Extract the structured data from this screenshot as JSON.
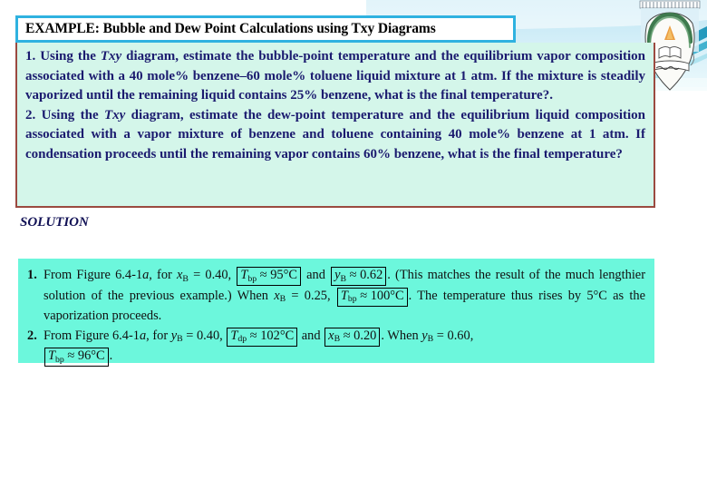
{
  "slide": {
    "title": "EXAMPLE: Bubble and Dew Point Calculations using Txy Diagrams",
    "solution_heading": "SOLUTION"
  },
  "colors": {
    "title_border": "#2FB2E0",
    "content_bg": "#D4F6EA",
    "content_border": "#9B4A40",
    "solution_bg": "#6CF7DC",
    "question_text": "#1B1B6F",
    "solution_text": "#111111",
    "background": "#FFFFFF",
    "deco_cyan": "#2FB2E0",
    "deco_pale": "#CDEAF4"
  },
  "questions": [
    {
      "number": "1.",
      "seg_a": "Using the ",
      "italic": "Txy",
      "seg_b": " diagram, estimate the bubble-point temperature and the equilibrium vapor composition associated with a 40 mole% benzene–60 mole% toluene liquid mixture at 1 atm. If the mixture is steadily vaporized until the remaining liquid contains 25% benzene, what is the final temperature?."
    },
    {
      "number": "2.",
      "seg_a": "Using the ",
      "italic": "Txy",
      "seg_b": " diagram, estimate the dew-point temperature and the equilibrium liquid composition associated with a vapor mixture of benzene and toluene containing 40 mole% benzene at 1 atm. If condensation proceeds until the remaining vapor contains 60% benzene, what is the final temperature?"
    }
  ],
  "solution": {
    "item1": {
      "number": "1.",
      "t1": "From Figure 6.4-1",
      "fig_ital": "a",
      "t2": ", for ",
      "var1": "x",
      "var1_sub": "B",
      "t3": " = 0.40, ",
      "box1_var": "T",
      "box1_sub": "bp",
      "box1_val": " ≈ 95°C",
      "t4": " and ",
      "box2_var": "y",
      "box2_sub": "B",
      "box2_val": " ≈ 0.62",
      "t5": ". (This matches the result of the much lengthier solution of the previous example.) When ",
      "var2": "x",
      "var2_sub": "B",
      "t6": " = 0.25, ",
      "box3_var": "T",
      "box3_sub": "bp",
      "box3_val": " ≈ 100°C",
      "t7": ". The temperature thus rises by 5°C as the vaporization proceeds."
    },
    "item2": {
      "number": "2.",
      "t1": "From  Figure  6.4-1",
      "fig_ital": "a",
      "t2": ",  for  ",
      "var1": "y",
      "var1_sub": "B",
      "t3": " = 0.40,  ",
      "box1_var": "T",
      "box1_sub": "dp",
      "box1_val": " ≈ 102°C",
      "t4": "  and  ",
      "box2_var": "x",
      "box2_sub": "B",
      "box2_val": " ≈ 0.20",
      "t5": ".  When  ",
      "var2": "y",
      "var2_sub": "B",
      "t6": " = 0.60,",
      "box3_var": "T",
      "box3_sub": "bp",
      "box3_val": " ≈ 96°C",
      "t7": "."
    }
  },
  "emblem": {
    "name": "university-crest"
  }
}
